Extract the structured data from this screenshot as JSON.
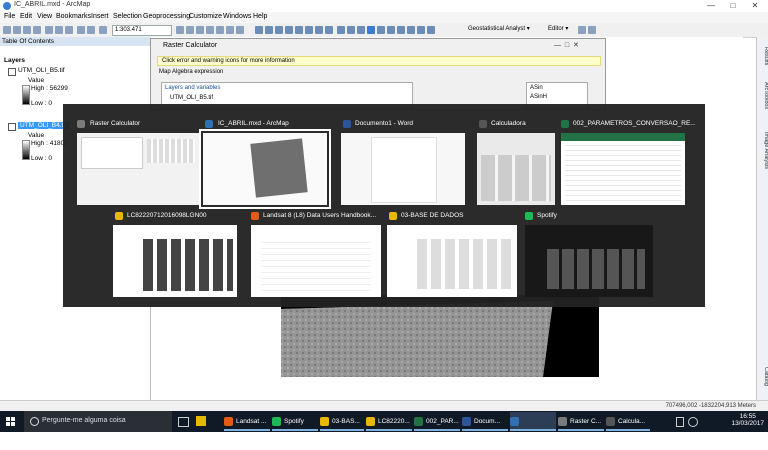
{
  "window": {
    "title": "IC_ABRIL.mxd - ArcMap"
  },
  "menu": [
    "File",
    "Edit",
    "View",
    "Bookmarks",
    "Insert",
    "Selection",
    "Geoprocessing",
    "Customize",
    "Windows",
    "Help"
  ],
  "toolbar": {
    "scale": "1:303.471",
    "geostat": "Geostatistical Analyst ▾",
    "editor": "Editor ▾"
  },
  "toc": {
    "title": "Table Of Contents",
    "layers_label": "Layers",
    "layer1": {
      "name": "UTM_OLI_B5.tif",
      "value_label": "Value",
      "high": "High : 56299",
      "low": "Low : 0"
    },
    "layer2": {
      "name": "UTM_OLI_B4.tif",
      "value_label": "Value",
      "high": "High : 41808",
      "low": "Low : 0"
    }
  },
  "raster_calculator": {
    "title": "Raster Calculator",
    "warning": "Click error and warning icons for more information",
    "expr_label": "Map Algebra expression",
    "layers_vars": "Layers and variables",
    "var1": "UTM_OLI_B5.tif",
    "func1": "ASin",
    "func2": "ASinH"
  },
  "right_tabs": [
    "Catalog",
    "Image Analysis",
    "ArcToolbox",
    "Results"
  ],
  "status": {
    "coords": "707496,002  -1832204,913 Meters"
  },
  "switcher": {
    "row1": [
      {
        "label": "Raster Calculator",
        "selected": false,
        "color": "#7a7a7a"
      },
      {
        "label": "IC_ABRIL.mxd - ArcMap",
        "selected": true,
        "color": "#2f6fb3"
      },
      {
        "label": "Documento1 - Word",
        "selected": false,
        "color": "#2b579a"
      },
      {
        "label": "Calculadora",
        "selected": false,
        "color": "#555555"
      },
      {
        "label": "002_PARAMETROS_CONVERSAO_RE...",
        "selected": false,
        "color": "#217346"
      }
    ],
    "row2": [
      {
        "label": "LC82220712016098LGN00",
        "color": "#e6b800"
      },
      {
        "label": "Landsat 8 (L8) Data Users Handbook...",
        "color": "#e55b13"
      },
      {
        "label": "03-BASE DE DADOS",
        "color": "#e6b800"
      },
      {
        "label": "Spotify",
        "color": "#1db954"
      }
    ]
  },
  "taskbar": {
    "search_placeholder": "Pergunte-me alguma coisa",
    "apps": [
      {
        "label": "Landsat ...",
        "color": "#e55b13"
      },
      {
        "label": "Spotify",
        "color": "#1db954"
      },
      {
        "label": "03-BAS...",
        "color": "#e6b800"
      },
      {
        "label": "LC82220...",
        "color": "#e6b800"
      },
      {
        "label": "002_PAR...",
        "color": "#217346"
      },
      {
        "label": "Docum...",
        "color": "#2b579a"
      },
      {
        "label": "IC_ABRIL...",
        "color": "#2f6fb3"
      },
      {
        "label": "Raster C...",
        "color": "#7a7a7a"
      },
      {
        "label": "Calcula...",
        "color": "#555555"
      }
    ],
    "time": "16:55",
    "date": "13/03/2017"
  }
}
